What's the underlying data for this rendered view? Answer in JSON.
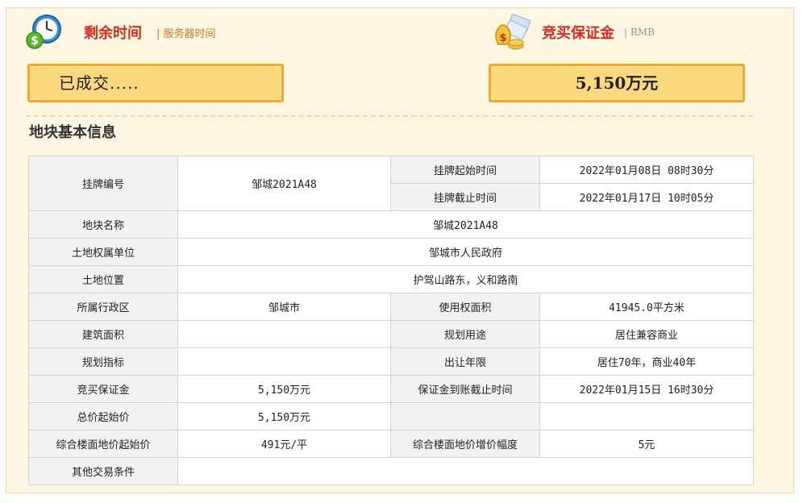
{
  "header": {
    "remaining_title": "剩余时间",
    "server_time_label": "| 服务器时间",
    "deposit_title": "竞买保证金",
    "currency_label": "| RMB"
  },
  "status_box": {
    "text": "已成交....."
  },
  "deposit_box": {
    "text": "5,150万元"
  },
  "section": {
    "title": "地块基本信息"
  },
  "table": {
    "listing_no_label": "挂牌编号",
    "listing_no_value": "邹城2021A48",
    "listing_start_label": "挂牌起始时间",
    "listing_start_value": "2022年01月08日 08时30分",
    "listing_end_label": "挂牌截止时间",
    "listing_end_value": "2022年01月17日 10时05分",
    "parcel_name_label": "地块名称",
    "parcel_name_value": "邹城2021A48",
    "owner_label": "土地权属单位",
    "owner_value": "邹城市人民政府",
    "location_label": "土地位置",
    "location_value": "护驾山路东，义和路南",
    "district_label": "所属行政区",
    "district_value": "邹城市",
    "area_label": "使用权面积",
    "area_value": "41945.0平方米",
    "building_area_label": "建筑面积",
    "building_area_value": "",
    "usage_label": "规划用途",
    "usage_value": "居住兼容商业",
    "planning_index_label": "规划指标",
    "planning_index_value": "",
    "term_label": "出让年限",
    "term_value": "居住70年，商业40年",
    "deposit_label": "竞买保证金",
    "deposit_value": "5,150万元",
    "deposit_deadline_label": "保证金到账截止时间",
    "deposit_deadline_value": "2022年01月15日 16时30分",
    "start_price_label": "总价起始价",
    "start_price_value": "5,150万元",
    "floor_price_label": "综合楼面地价起始价",
    "floor_price_value": "491元/平",
    "floor_increment_label": "综合楼面地价增价幅度",
    "floor_increment_value": "5元",
    "other_terms_label": "其他交易条件",
    "other_terms_value": ""
  },
  "icons": {
    "timer": "clock-dollar-icon",
    "deposit": "money-bag-icon"
  },
  "colors": {
    "accent_red": "#d62b1f",
    "box_fill": "#fcd97d",
    "box_border": "#f1a82b",
    "panel_bg": "#fdf6e1"
  }
}
